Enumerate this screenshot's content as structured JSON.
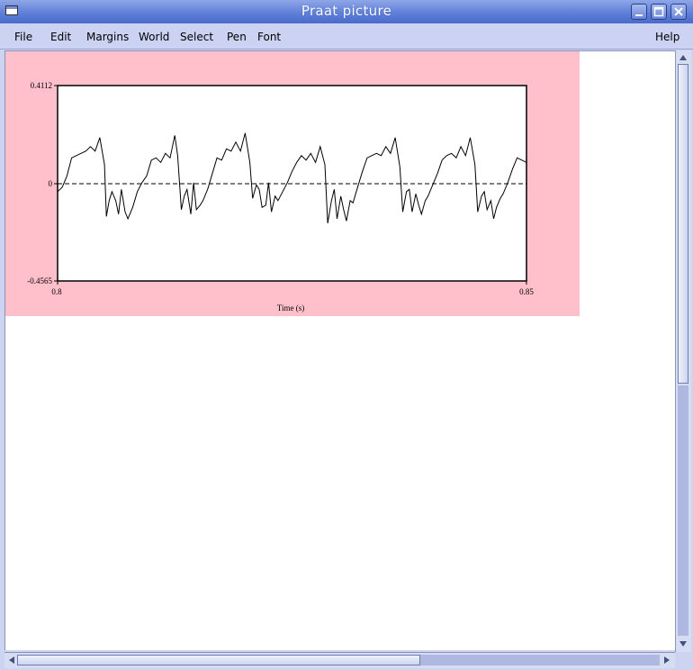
{
  "window": {
    "title": "Praat picture"
  },
  "menubar": {
    "items": [
      "File",
      "Edit",
      "Margins",
      "World",
      "Select",
      "Pen",
      "Font"
    ],
    "help": "Help"
  },
  "colors": {
    "selection": "#ffc0cb",
    "titlebar": "#5f7fd8",
    "menubar": "#ccd3f2"
  },
  "chart_data": {
    "type": "line",
    "xlabel": "Time (s)",
    "ylabel": "",
    "xlim": [
      0.8,
      0.85
    ],
    "ylim": [
      -0.4565,
      0.4112
    ],
    "x_ticks": [
      "0.8",
      "0.85"
    ],
    "y_ticks": [
      "0.4112",
      "0",
      "-0.4565"
    ],
    "zero_line": "dashed",
    "series": [
      {
        "x": [
          0.8,
          0.8005,
          0.801,
          0.8015,
          0.802,
          0.8025,
          0.803,
          0.8035,
          0.804,
          0.8045,
          0.805,
          0.8052,
          0.8055,
          0.8058,
          0.8062,
          0.8065,
          0.8068,
          0.8072,
          0.8075,
          0.808,
          0.8085,
          0.809,
          0.8095,
          0.81,
          0.8105,
          0.811,
          0.8115,
          0.812,
          0.8125,
          0.8128,
          0.8132,
          0.8135,
          0.8138,
          0.8142,
          0.8145,
          0.8148,
          0.8152,
          0.8155,
          0.816,
          0.8165,
          0.817,
          0.8175,
          0.818,
          0.8185,
          0.819,
          0.8195,
          0.82,
          0.8205,
          0.8208,
          0.8212,
          0.8215,
          0.8218,
          0.8222,
          0.8225,
          0.8228,
          0.8232,
          0.8235,
          0.824,
          0.8245,
          0.825,
          0.8255,
          0.826,
          0.8265,
          0.827,
          0.8275,
          0.828,
          0.8285,
          0.8288,
          0.8292,
          0.8295,
          0.8298,
          0.8302,
          0.8305,
          0.8308,
          0.8312,
          0.8315,
          0.832,
          0.8325,
          0.833,
          0.8335,
          0.834,
          0.8345,
          0.835,
          0.8355,
          0.836,
          0.8365,
          0.8368,
          0.8372,
          0.8375,
          0.8378,
          0.8382,
          0.8385,
          0.8388,
          0.8392,
          0.8395,
          0.84,
          0.8405,
          0.841,
          0.8415,
          0.842,
          0.8425,
          0.843,
          0.8435,
          0.844,
          0.8445,
          0.8448,
          0.8452,
          0.8455,
          0.8458,
          0.8462,
          0.8465,
          0.8468,
          0.8472,
          0.8475,
          0.848,
          0.8485,
          0.849,
          0.8495,
          0.85
        ],
        "y": [
          -0.06,
          -0.04,
          0.01,
          0.09,
          0.1,
          0.11,
          0.12,
          0.14,
          0.12,
          0.18,
          0.06,
          -0.17,
          -0.1,
          -0.06,
          -0.1,
          -0.16,
          -0.05,
          -0.15,
          -0.18,
          -0.13,
          -0.06,
          -0.02,
          0.01,
          0.08,
          0.09,
          0.07,
          0.11,
          0.09,
          0.19,
          0.1,
          -0.14,
          -0.08,
          -0.05,
          -0.16,
          -0.02,
          -0.14,
          -0.12,
          -0.1,
          -0.05,
          0.02,
          0.09,
          0.08,
          0.13,
          0.12,
          0.16,
          0.12,
          0.2,
          0.07,
          -0.09,
          -0.03,
          -0.05,
          -0.13,
          -0.12,
          -0.02,
          -0.15,
          -0.08,
          -0.1,
          -0.06,
          -0.02,
          0.03,
          0.07,
          0.1,
          0.08,
          0.11,
          0.07,
          0.14,
          0.06,
          -0.2,
          -0.1,
          -0.05,
          -0.18,
          -0.08,
          -0.14,
          -0.19,
          -0.1,
          -0.11,
          -0.04,
          0.03,
          0.09,
          0.1,
          0.11,
          0.1,
          0.14,
          0.11,
          0.18,
          0.05,
          -0.15,
          -0.06,
          -0.05,
          -0.15,
          -0.07,
          -0.12,
          -0.16,
          -0.1,
          -0.08,
          -0.03,
          0.02,
          0.08,
          0.1,
          0.11,
          0.09,
          0.14,
          0.1,
          0.18,
          0.06,
          -0.15,
          -0.08,
          -0.06,
          -0.14,
          -0.1,
          -0.18,
          -0.13,
          -0.09,
          -0.07,
          -0.02,
          0.04,
          0.09,
          0.08,
          0.07
        ]
      }
    ]
  }
}
